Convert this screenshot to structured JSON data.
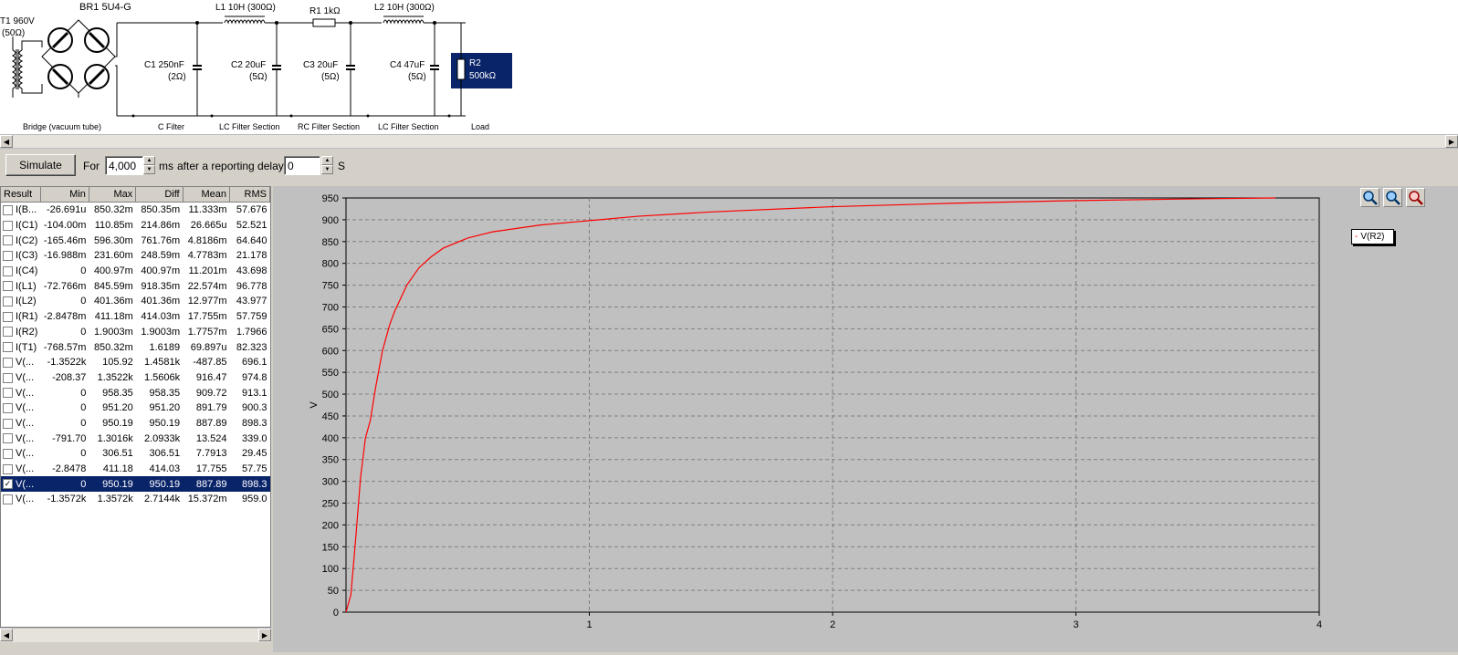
{
  "schematic": {
    "labels": {
      "t1_name": "T1 960V",
      "t1_res": "(50Ω)",
      "br1": "BR1 5U4-G",
      "l1": "L1 10H (300Ω)",
      "r1": "R1 1kΩ",
      "l2": "L2 10H (300Ω)",
      "c1": "C1 250nF",
      "c1_res": "(2Ω)",
      "c2": "C2 20uF",
      "c2_res": "(5Ω)",
      "c3": "C3 20uF",
      "c3_res": "(5Ω)",
      "c4": "C4 47uF",
      "c4_res": "(5Ω)",
      "r2_name": "R2",
      "r2_value": "500kΩ"
    },
    "sections": [
      "Bridge (vacuum tube)",
      "C Filter",
      "LC Filter Section",
      "RC Filter Section",
      "LC Filter Section",
      "Load"
    ]
  },
  "toolbar": {
    "simulate_label": "Simulate",
    "for_label": "For",
    "duration_value": "4,000",
    "ms_label": "ms",
    "delay_label": "after a reporting delay of",
    "delay_value": "0",
    "s_label": "S"
  },
  "results": {
    "columns": [
      "Result",
      "Min",
      "Max",
      "Diff",
      "Mean",
      "RMS"
    ],
    "rows": [
      {
        "name": "I(B...",
        "min": "-26.691u",
        "max": "850.32m",
        "diff": "850.35m",
        "mean": "11.333m",
        "rms": "57.676",
        "checked": false
      },
      {
        "name": "I(C1)",
        "min": "-104.00m",
        "max": "110.85m",
        "diff": "214.86m",
        "mean": "26.665u",
        "rms": "52.521",
        "checked": false
      },
      {
        "name": "I(C2)",
        "min": "-165.46m",
        "max": "596.30m",
        "diff": "761.76m",
        "mean": "4.8186m",
        "rms": "64.640",
        "checked": false
      },
      {
        "name": "I(C3)",
        "min": "-16.988m",
        "max": "231.60m",
        "diff": "248.59m",
        "mean": "4.7783m",
        "rms": "21.178",
        "checked": false
      },
      {
        "name": "I(C4)",
        "min": "0",
        "max": "400.97m",
        "diff": "400.97m",
        "mean": "11.201m",
        "rms": "43.698",
        "checked": false
      },
      {
        "name": "I(L1)",
        "min": "-72.766m",
        "max": "845.59m",
        "diff": "918.35m",
        "mean": "22.574m",
        "rms": "96.778",
        "checked": false
      },
      {
        "name": "I(L2)",
        "min": "0",
        "max": "401.36m",
        "diff": "401.36m",
        "mean": "12.977m",
        "rms": "43.977",
        "checked": false
      },
      {
        "name": "I(R1)",
        "min": "-2.8478m",
        "max": "411.18m",
        "diff": "414.03m",
        "mean": "17.755m",
        "rms": "57.759",
        "checked": false
      },
      {
        "name": "I(R2)",
        "min": "0",
        "max": "1.9003m",
        "diff": "1.9003m",
        "mean": "1.7757m",
        "rms": "1.7966",
        "checked": false
      },
      {
        "name": "I(T1)",
        "min": "-768.57m",
        "max": "850.32m",
        "diff": "1.6189",
        "mean": "69.897u",
        "rms": "82.323",
        "checked": false
      },
      {
        "name": "V(...",
        "min": "-1.3522k",
        "max": "105.92",
        "diff": "1.4581k",
        "mean": "-487.85",
        "rms": "696.1",
        "checked": false
      },
      {
        "name": "V(...",
        "min": "-208.37",
        "max": "1.3522k",
        "diff": "1.5606k",
        "mean": "916.47",
        "rms": "974.8",
        "checked": false
      },
      {
        "name": "V(...",
        "min": "0",
        "max": "958.35",
        "diff": "958.35",
        "mean": "909.72",
        "rms": "913.1",
        "checked": false
      },
      {
        "name": "V(...",
        "min": "0",
        "max": "951.20",
        "diff": "951.20",
        "mean": "891.79",
        "rms": "900.3",
        "checked": false
      },
      {
        "name": "V(...",
        "min": "0",
        "max": "950.19",
        "diff": "950.19",
        "mean": "887.89",
        "rms": "898.3",
        "checked": false
      },
      {
        "name": "V(...",
        "min": "-791.70",
        "max": "1.3016k",
        "diff": "2.0933k",
        "mean": "13.524",
        "rms": "339.0",
        "checked": false
      },
      {
        "name": "V(...",
        "min": "0",
        "max": "306.51",
        "diff": "306.51",
        "mean": "7.7913",
        "rms": "29.45",
        "checked": false
      },
      {
        "name": "V(...",
        "min": "-2.8478",
        "max": "411.18",
        "diff": "414.03",
        "mean": "17.755",
        "rms": "57.75",
        "checked": false
      },
      {
        "name": "V(...",
        "min": "0",
        "max": "950.19",
        "diff": "950.19",
        "mean": "887.89",
        "rms": "898.3",
        "checked": true
      },
      {
        "name": "V(...",
        "min": "-1.3572k",
        "max": "1.3572k",
        "diff": "2.7144k",
        "mean": "15.372m",
        "rms": "959.0",
        "checked": false
      }
    ]
  },
  "chart_data": {
    "type": "line",
    "ylabel": "V",
    "xlim": [
      0,
      4
    ],
    "ylim": [
      0,
      950
    ],
    "x_ticks": [
      "1",
      "2",
      "3",
      "4"
    ],
    "y_ticks": [
      "0",
      "50",
      "100",
      "150",
      "200",
      "250",
      "300",
      "350",
      "400",
      "450",
      "500",
      "550",
      "600",
      "650",
      "700",
      "750",
      "800",
      "850",
      "900",
      "950"
    ],
    "grid": true,
    "legend_position": "top-right",
    "series": [
      {
        "name": "V(R2)",
        "color": "#ff0000",
        "x": [
          0,
          0.02,
          0.04,
          0.06,
          0.08,
          0.1,
          0.12,
          0.15,
          0.18,
          0.2,
          0.25,
          0.3,
          0.35,
          0.4,
          0.5,
          0.6,
          0.8,
          1.0,
          1.2,
          1.5,
          2.0,
          2.5,
          3.0,
          3.5,
          3.82
        ],
        "y": [
          0,
          40,
          170,
          310,
          400,
          440,
          510,
          600,
          660,
          690,
          750,
          790,
          815,
          835,
          858,
          872,
          888,
          898,
          908,
          918,
          930,
          938,
          944,
          948,
          950
        ]
      }
    ]
  },
  "colors": {
    "window_bg": "#d4d0c8",
    "plot_bg": "#c0c0c0",
    "selection": "#0a246a",
    "series": "#ff0000"
  }
}
